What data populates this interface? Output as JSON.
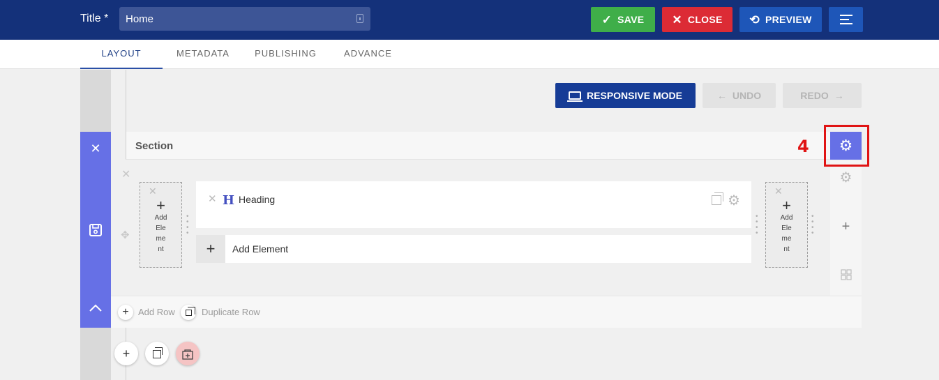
{
  "header": {
    "title_label": "Title *",
    "title_value": "Home",
    "save_label": "SAVE",
    "close_label": "CLOSE",
    "preview_label": "PREVIEW",
    "colors": {
      "bar": "#14317a",
      "save": "#3fae49",
      "close": "#dc2b35",
      "preview": "#1e56b8"
    }
  },
  "tabs": [
    {
      "label": "LAYOUT",
      "active": true
    },
    {
      "label": "METADATA",
      "active": false
    },
    {
      "label": "PUBLISHING",
      "active": false
    },
    {
      "label": "ADVANCE",
      "active": false
    }
  ],
  "toolbar": {
    "responsive_label": "RESPONSIVE MODE",
    "undo_label": "UNDO",
    "redo_label": "REDO"
  },
  "section": {
    "title": "Section",
    "accent_color": "#6670e6",
    "step_marker": "4",
    "columns": {
      "left_add_label": "Add\nEle\nme\nnt",
      "right_add_label": "Add\nEle\nme\nnt"
    },
    "element": {
      "name": "Heading",
      "icon": "heading-icon"
    },
    "add_element_label": "Add Element",
    "row_footer": {
      "add_row_label": "Add Row",
      "duplicate_row_label": "Duplicate Row"
    }
  }
}
